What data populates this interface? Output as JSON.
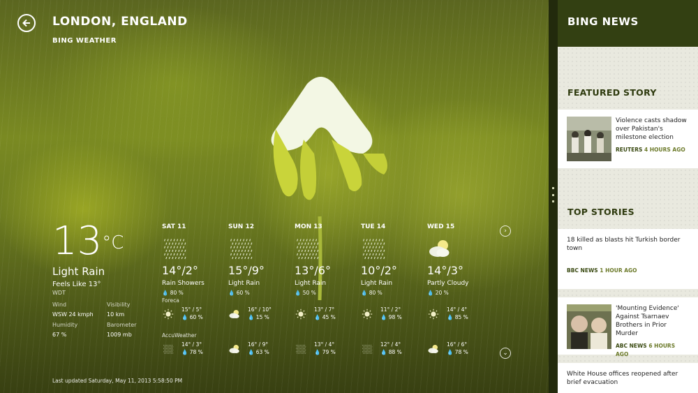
{
  "weather": {
    "city": "LONDON, ENGLAND",
    "provider": "BING WEATHER",
    "current": {
      "temp": "13",
      "unit": "°C",
      "condition": "Light Rain",
      "feels_like": "Feels Like 13°",
      "station": "WDT",
      "wind_label": "Wind",
      "wind_value": "WSW 24 kmph",
      "visibility_label": "Visibility",
      "visibility_value": "10 km",
      "humidity_label": "Humidity",
      "humidity_value": "67 %",
      "barometer_label": "Barometer",
      "barometer_value": "1009 mb"
    },
    "forecast": [
      {
        "day": "SAT 11",
        "range": "14°/2°",
        "condition": "Rain Showers",
        "precip": "80 %",
        "icon": "rain-icon",
        "foreca_label": "Foreca",
        "foreca_range": "15° / 5°",
        "foreca_precip": "60 %",
        "foreca_icon": "sun-icon",
        "accu_label": "AccuWeather",
        "accu_range": "14° / 3°",
        "accu_precip": "78 %",
        "accu_icon": "rain-icon"
      },
      {
        "day": "SUN 12",
        "range": "15°/9°",
        "condition": "Light Rain",
        "precip": "60 %",
        "icon": "rain-icon",
        "foreca_label": "",
        "foreca_range": "16° / 10°",
        "foreca_precip": "15 %",
        "foreca_icon": "partly-cloudy-icon",
        "accu_label": "",
        "accu_range": "16° / 9°",
        "accu_precip": "63 %",
        "accu_icon": "partly-cloudy-icon"
      },
      {
        "day": "MON 13",
        "range": "13°/6°",
        "condition": "Light Rain",
        "precip": "50 %",
        "icon": "rain-icon",
        "foreca_label": "",
        "foreca_range": "13° / 7°",
        "foreca_precip": "45 %",
        "foreca_icon": "sun-icon",
        "accu_label": "",
        "accu_range": "13° / 4°",
        "accu_precip": "79 %",
        "accu_icon": "rain-icon"
      },
      {
        "day": "TUE 14",
        "range": "10°/2°",
        "condition": "Light Rain",
        "precip": "80 %",
        "icon": "rain-icon",
        "foreca_label": "",
        "foreca_range": "11° / 2°",
        "foreca_precip": "98 %",
        "foreca_icon": "sun-icon",
        "accu_label": "",
        "accu_range": "12° / 4°",
        "accu_precip": "88 %",
        "accu_icon": "rain-icon"
      },
      {
        "day": "WED 15",
        "range": "14°/3°",
        "condition": "Partly Cloudy",
        "precip": "20 %",
        "icon": "partly-cloudy-icon",
        "foreca_label": "",
        "foreca_range": "14° / 4°",
        "foreca_precip": "85 %",
        "foreca_icon": "sun-icon",
        "accu_label": "",
        "accu_range": "16° / 6°",
        "accu_precip": "78 %",
        "accu_icon": "partly-cloudy-icon"
      }
    ],
    "last_updated": "Last updated Saturday, May 11, 2013 5:58:50 PM"
  },
  "news": {
    "header": "BING NEWS",
    "featured_heading": "FEATURED STORY",
    "featured": {
      "headline": "Violence casts shadow over Pakistan's milestone election",
      "source": "REUTERS",
      "ago": "4 HOURS AGO"
    },
    "top_heading": "TOP STORIES",
    "stories": [
      {
        "headline": "18 killed as blasts hit Turkish border town",
        "source": "BBC NEWS",
        "ago": "1 HOUR AGO"
      },
      {
        "headline": "'Mounting Evidence' Against Tsarnaev Brothers in Prior Murder",
        "source": "ABC NEWS",
        "ago": "6 HOURS AGO"
      },
      {
        "headline": "White House offices reopened after brief evacuation",
        "source": "",
        "ago": ""
      }
    ]
  },
  "colors": {
    "accent": "#334012",
    "panel_bg": "#e9e9df"
  }
}
